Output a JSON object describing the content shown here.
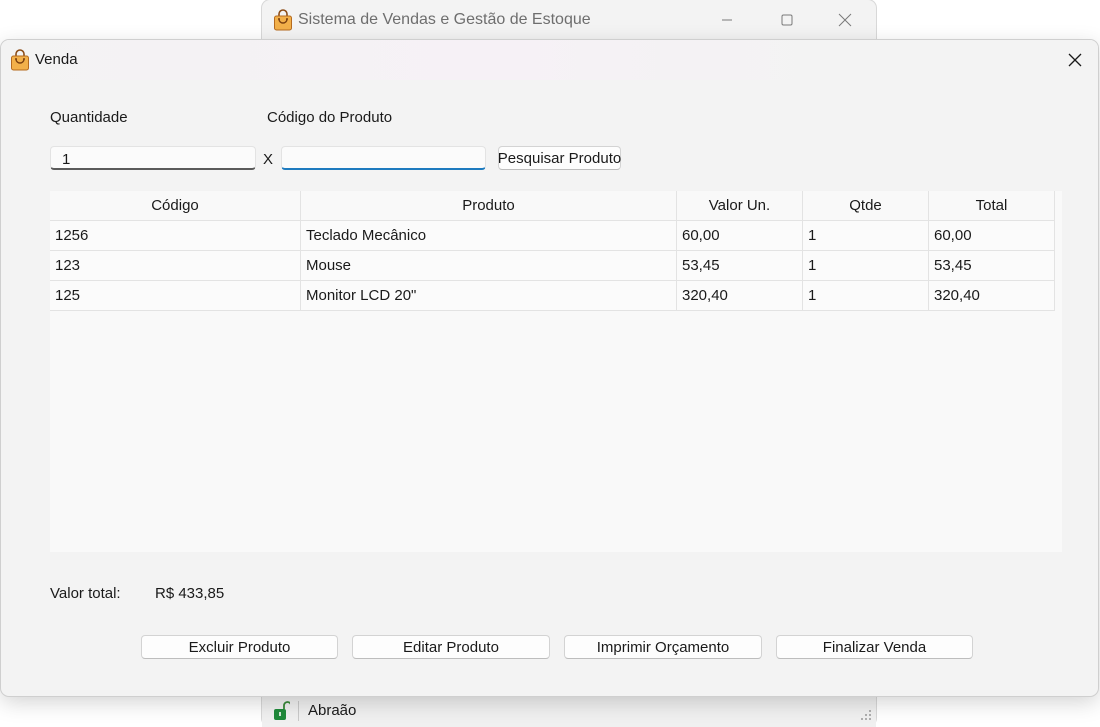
{
  "main_window": {
    "title": "Sistema de Vendas e Gestão de Estoque",
    "app_icon": "shopping-bag-icon",
    "controls": {
      "minimize": "minimize-icon",
      "maximize": "maximize-icon",
      "close": "close-icon"
    },
    "status_bar": {
      "user": "Abraão",
      "user_icon": "unlocked-padlock-icon"
    }
  },
  "dialog": {
    "title": "Venda",
    "icon": "shopping-bag-icon",
    "quantity_label": "Quantidade",
    "product_code_label": "Código do Produto",
    "quantity_value": "1",
    "multiply_sign": "X",
    "product_code_value": "",
    "search_button": "Pesquisar Produto",
    "table": {
      "columns": [
        "Código",
        "Produto",
        "Valor Un.",
        "Qtde",
        "Total"
      ],
      "rows": [
        [
          "1256",
          "Teclado Mecânico",
          "60,00",
          "1",
          "60,00"
        ],
        [
          "123",
          "Mouse",
          "53,45",
          "1",
          "53,45"
        ],
        [
          "125",
          "Monitor LCD 20\"",
          "320,40",
          "1",
          "320,40"
        ]
      ]
    },
    "total_label": "Valor total:",
    "total_value": "R$ 433,85",
    "buttons": {
      "delete": "Excluir Produto",
      "edit": "Editar Produto",
      "print": "Imprimir Orçamento",
      "finish": "Finalizar Venda"
    },
    "colors": {
      "accent": "#1e7bbf",
      "bag": "#e8a33a"
    }
  }
}
